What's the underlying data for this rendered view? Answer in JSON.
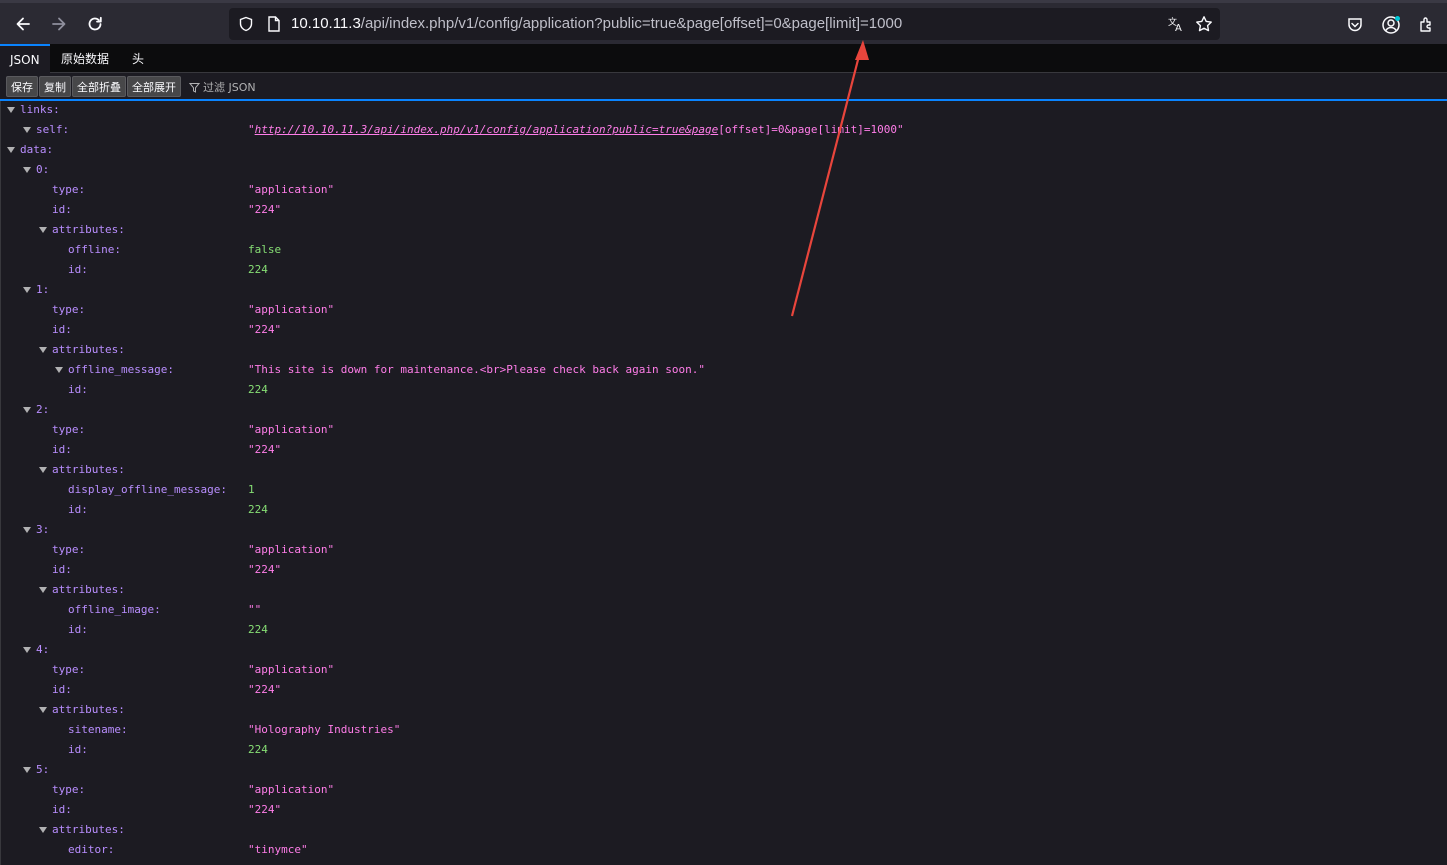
{
  "browser": {
    "url_host": "10.10.11.3",
    "url_path": "/api/index.php/v1/config/application?public=true&page[offset]=0&page[limit]=1000"
  },
  "tabs": [
    {
      "label": "JSON",
      "active": true
    },
    {
      "label": "原始数据",
      "active": false
    },
    {
      "label": "头",
      "active": false
    }
  ],
  "actions": {
    "save": "保存",
    "copy": "复制",
    "collapse_all": "全部折叠",
    "expand_all": "全部展开",
    "filter_placeholder": "过滤 JSON"
  },
  "json": {
    "links_key": "links:",
    "self_key": "self:",
    "self_link": "http://10.10.11.3/api/index.php/v1/config/application?public=true&page",
    "self_rest": "[offset]=0&page[limit]=1000\"",
    "data_key": "data:",
    "items": [
      {
        "index": "0:",
        "type": "\"application\"",
        "id": "\"224\"",
        "attr_key": "offline:",
        "attr_val": "false",
        "attr_kind": "bool",
        "attr_id": "224"
      },
      {
        "index": "1:",
        "type": "\"application\"",
        "id": "\"224\"",
        "attr_key": "offline_message:",
        "attr_val": "\"This site is down for maintenance.<br>Please check back again soon.\"",
        "attr_kind": "string",
        "attr_id": "224"
      },
      {
        "index": "2:",
        "type": "\"application\"",
        "id": "\"224\"",
        "attr_key": "display_offline_message:",
        "attr_val": "1",
        "attr_kind": "number",
        "attr_id": "224"
      },
      {
        "index": "3:",
        "type": "\"application\"",
        "id": "\"224\"",
        "attr_key": "offline_image:",
        "attr_val": "\"\"",
        "attr_kind": "string",
        "attr_id": "224"
      },
      {
        "index": "4:",
        "type": "\"application\"",
        "id": "\"224\"",
        "attr_key": "sitename:",
        "attr_val": "\"Holography Industries\"",
        "attr_kind": "string",
        "attr_id": "224"
      },
      {
        "index": "5:",
        "type": "\"application\"",
        "id": "\"224\"",
        "attr_key": "editor:",
        "attr_val": "\"tinymce\"",
        "attr_kind": "string",
        "attr_id": null
      }
    ],
    "labels": {
      "type": "type:",
      "id": "id:",
      "attributes": "attributes:"
    }
  },
  "colors": {
    "accent": "#0a84ff",
    "key": "#b98eff",
    "string": "#ff7de9",
    "number": "#86de74",
    "annotation_arrow": "#e8453c"
  }
}
